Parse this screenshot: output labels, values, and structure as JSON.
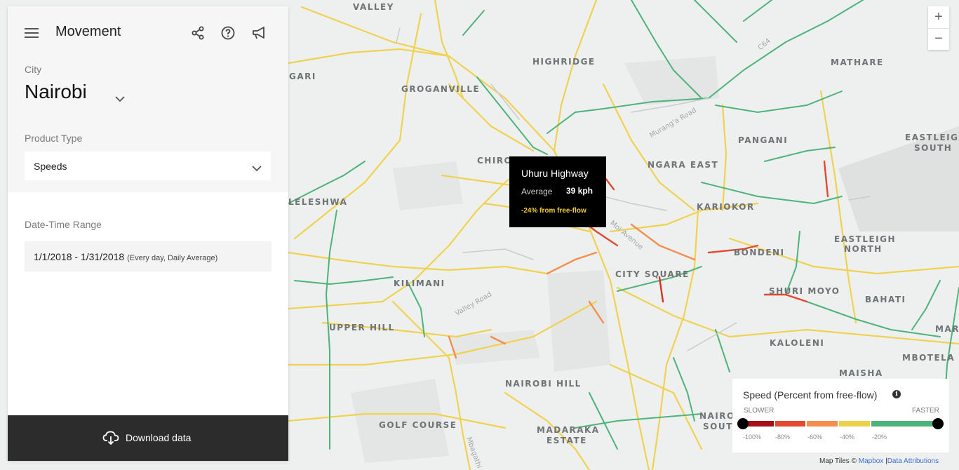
{
  "panel": {
    "title": "Movement",
    "city_label": "City",
    "city_value": "Nairobi",
    "product_label": "Product Type",
    "product_value": "Speeds",
    "date_label": "Date-Time Range",
    "date_value": "1/1/2018 - 1/31/2018",
    "date_detail": "(Every day, Daily Average)",
    "download_label": "Download data"
  },
  "tooltip": {
    "road": "Uhuru Highway",
    "average_label": "Average",
    "average_value": "39 kph",
    "delta": "-24% from free-flow"
  },
  "zoom": {
    "in": "+",
    "out": "−"
  },
  "legend": {
    "title": "Speed (Percent from free-flow)",
    "slower": "SLOWER",
    "faster": "FASTER",
    "ticks": [
      "-100%",
      "-80%",
      "-60%",
      "-40%",
      "-20%"
    ],
    "colors": [
      "#a50f15",
      "#e2492e",
      "#f58d4f",
      "#ecd24a",
      "#4db37a"
    ]
  },
  "attribution": {
    "prefix": "Map Tiles ©",
    "mapbox": "Mapbox",
    "data": "Data Attributions"
  },
  "places": {
    "valley": "VALLEY",
    "highridge": "HIGHRIDGE",
    "mathare": "MATHARE",
    "gari": "GARI",
    "groganville": "GROGANVILLE",
    "pangani": "PANGANI",
    "eastleigh_south_1": "EASTLEIGH",
    "eastleigh_south_2": "SOUTH",
    "chiro": "CHIRO",
    "ngara_east": "NGARA EAST",
    "kileleshwa": "LELESHWA",
    "kariokor": "KARIOKOR",
    "eastleigh_north_1": "EASTLEIGH",
    "eastleigh_north_2": "NORTH",
    "bondeni": "BONDENI",
    "kilimani": "KILIMANI",
    "city_square": "CITY SQUARE",
    "shauri_moyo": "SHURI MOYO",
    "bahati": "BAHATI",
    "upper_hill": "UPPER HILL",
    "kaloleni": "KALOLENI",
    "mar": "MAR",
    "mbotela": "MBOTELA",
    "maisha": "MAISHA",
    "nairobi_hill": "NAIROBI HILL",
    "golf_course": "GOLF COURSE",
    "madaraka_1": "MADARAKA",
    "madaraka_2": "ESTATE",
    "nairobi_south_1": "NAIRO",
    "nairobi_south_2": "SOUTH"
  },
  "roads": {
    "murang_a": "Murang'a Road",
    "moi": "Moi Avenue",
    "valley_road": "Valley Road",
    "mbagathi": "Mbagathi",
    "c64": "C64"
  }
}
